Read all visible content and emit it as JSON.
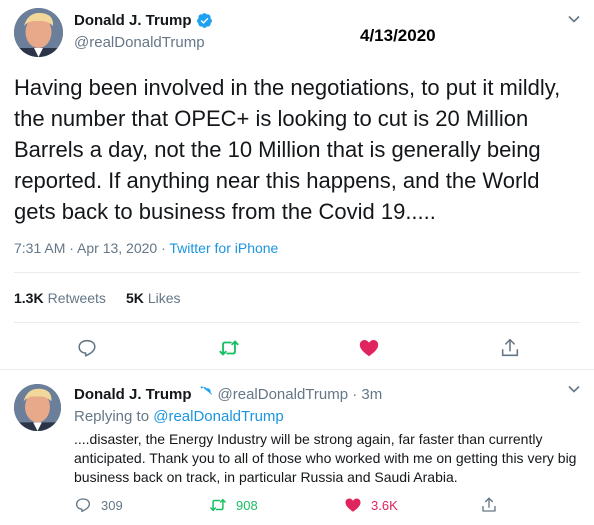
{
  "date_stamp": "4/13/2020",
  "main_tweet": {
    "name": "Donald J. Trump",
    "handle": "@realDonaldTrump",
    "text": "Having been involved in the negotiations, to put it mildly, the number that OPEC+ is looking to cut is 20 Million Barrels a day, not the 10 Million that is generally being reported. If anything near this happens, and the World gets back to business from the Covid 19.....",
    "time": "7:31 AM · Apr 13, 2020 · ",
    "source": "Twitter for iPhone",
    "retweets_count": "1.3K",
    "retweets_label": "Retweets",
    "likes_count": "5K",
    "likes_label": "Likes"
  },
  "reply_tweet": {
    "name": "Donald J. Trump",
    "handle_time": "@realDonaldTrump · 3m",
    "replying_prefix": "Replying to ",
    "replying_to": "@realDonaldTrump",
    "text": "....disaster, the Energy Industry will be strong again, far faster than currently anticipated. Thank you to all of those who worked with me on getting this very big business back on track, in particular Russia and Saudi Arabia.",
    "reply_count": "309",
    "retweet_count": "908",
    "like_count": "3.6K"
  },
  "colors": {
    "retweet_green": "#17bf63",
    "like_red": "#e0245e",
    "link_blue": "#1b95e0",
    "secondary_gray": "#657786"
  },
  "icons": [
    "verified-badge-icon",
    "chevron-down-icon",
    "reply-icon",
    "retweet-icon",
    "like-heart-icon",
    "share-icon"
  ]
}
